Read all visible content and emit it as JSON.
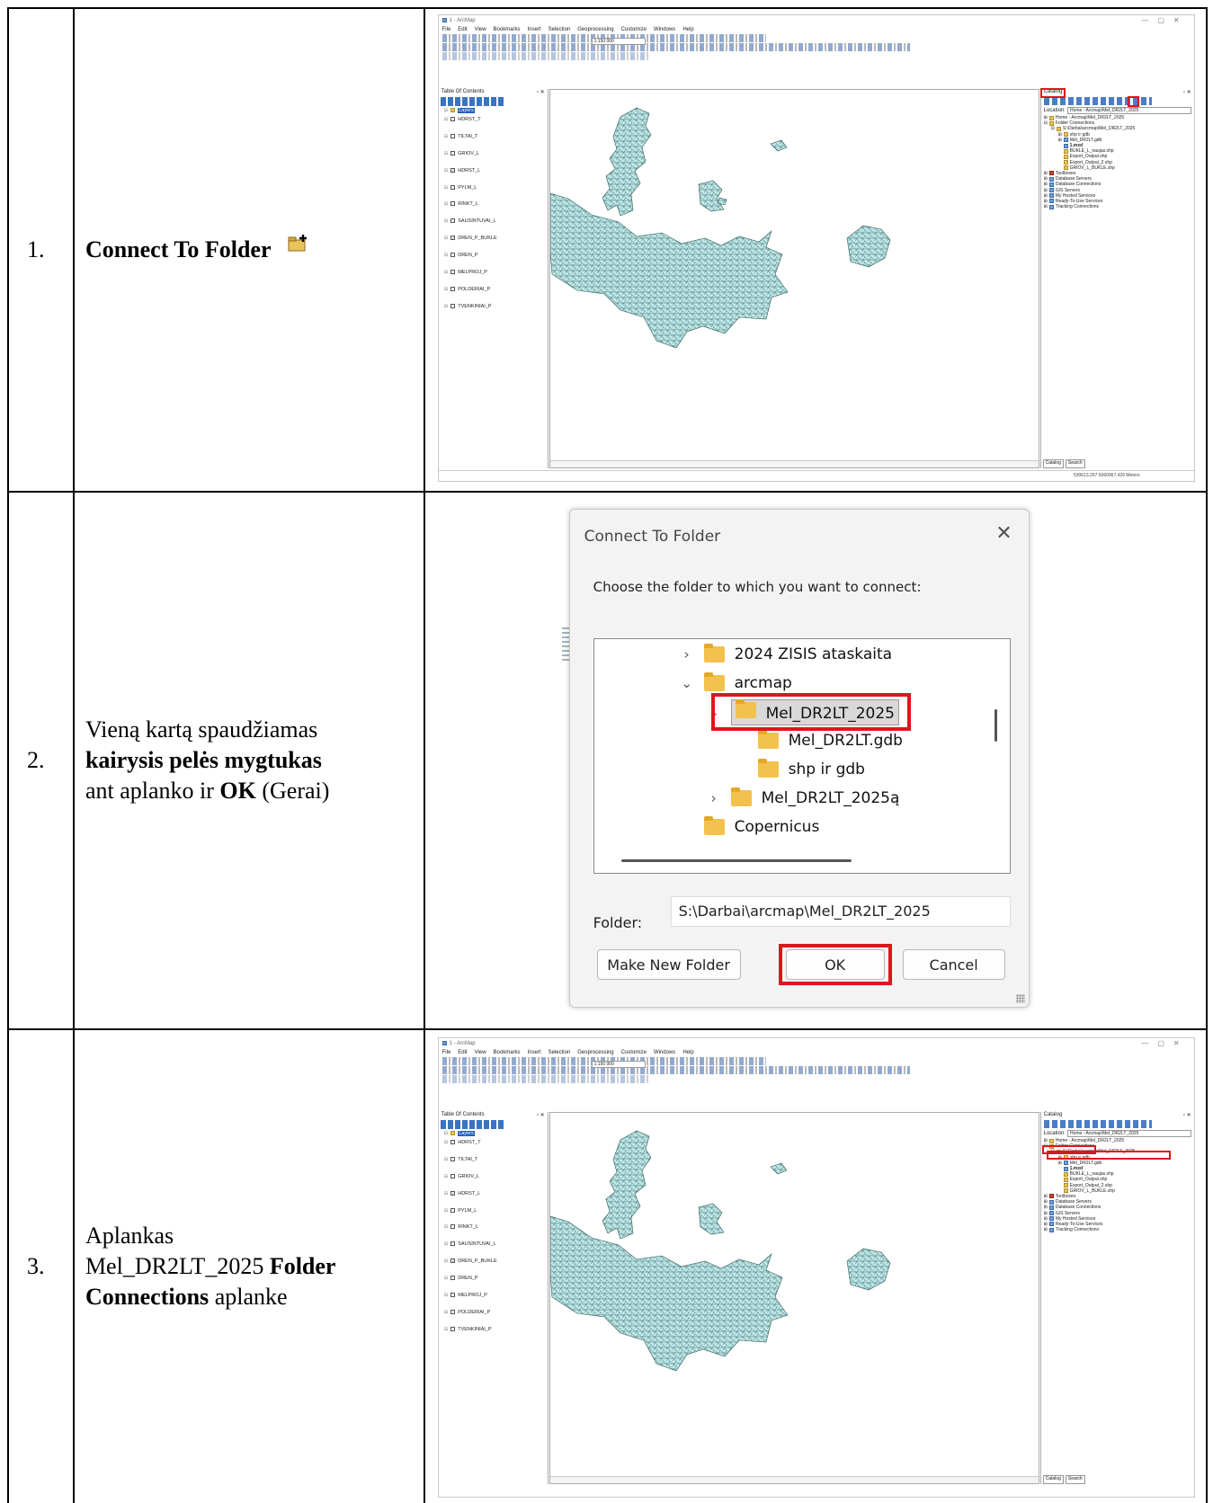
{
  "steps": [
    {
      "num": "1.",
      "title": "Connect To Folder"
    },
    {
      "num": "2.",
      "text_a": "Vieną kartą spaudžiamas",
      "bold_a": "kairysis pelės mygtukas",
      "text_b": "ant aplanko ir",
      "bold_b": "OK",
      "text_c": "(Gerai)"
    },
    {
      "num": "3.",
      "text_a": "Aplankas",
      "text_b": "Mel_DR2LT_2025",
      "bold_a": "Folder",
      "bold_b": "Connections",
      "text_c": "aplanke"
    }
  ],
  "arcmap": {
    "title": "1 - ArcMap",
    "menu": [
      "File",
      "Edit",
      "View",
      "Bookmarks",
      "Insert",
      "Selection",
      "Geoprocessing",
      "Customize",
      "Windows",
      "Help"
    ],
    "scale": "1:150 000",
    "editor": "Editor",
    "toc_title": "Table Of Contents",
    "toc_root": "Layers",
    "toc_layers": [
      "HDRST_T",
      "TILTAI_T",
      "GRIOV_L",
      "HDRST_L",
      "PYLM_L",
      "RINKT_L",
      "SAUSINTUVAI_L",
      "DREN_P_BUKLE",
      "DREN_P",
      "MELPROJ_P",
      "POLDERIAI_P",
      "TVENKINIAI_P"
    ],
    "catalog_title": "Catalog",
    "location_label": "Location:",
    "location_value": "Home - Arcmap\\Mel_DR2LT_2025",
    "catalog_items": [
      "Home - Arcmap\\Mel_DR2LT_2025",
      "Folder Connections",
      "S:\\Darbai\\arcmap\\Mel_DR2LT_2025",
      "shp ir gdb",
      "Mel_DR2LT.gdb",
      "1.mxd",
      "BUKLE_L_naujas.shp",
      "Export_Output.shp",
      "Export_Output_2.shp",
      "GRIOV_L_BUKLE.shp",
      "Toolboxes",
      "Database Servers",
      "Database Connections",
      "GIS Servers",
      "My Hosted Services",
      "Ready-To-Use Services",
      "Tracking Connections"
    ],
    "tab_catalog": "Catalog",
    "tab_search": "Search",
    "coords": "530613,297  6060967,429 Meters"
  },
  "dialog": {
    "title": "Connect To Folder",
    "prompt": "Choose the folder to which you want to connect:",
    "folders": [
      "2024 ZISIS ataskaita",
      "arcmap",
      "Mel_DR2LT_2025",
      "Mel_DR2LT.gdb",
      "shp ir gdb",
      "Mel_DR2LT_2025ą",
      "Copernicus"
    ],
    "folder_label": "Folder:",
    "folder_value": "S:\\Darbai\\arcmap\\Mel_DR2LT_2025",
    "btn_new": "Make New Folder",
    "btn_ok": "OK",
    "btn_cancel": "Cancel"
  },
  "colors": {
    "highlight": "#e0141b",
    "map_fill": "#bfe8e8",
    "map_stroke": "#2f5a5a"
  }
}
